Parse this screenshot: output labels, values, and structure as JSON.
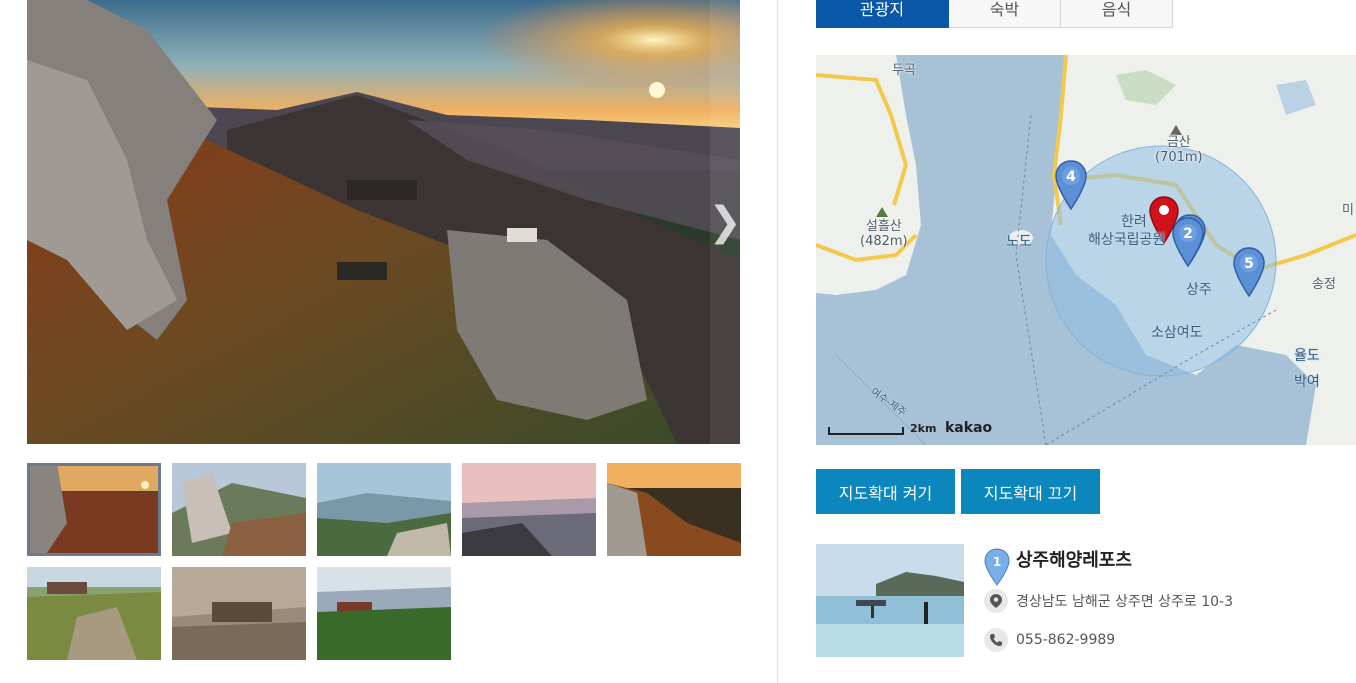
{
  "gallery": {
    "next_arrow": "❯",
    "thumbnails": [
      "thumb-1",
      "thumb-2",
      "thumb-3",
      "thumb-4",
      "thumb-5",
      "thumb-6",
      "thumb-7",
      "thumb-8"
    ],
    "active_index": 0
  },
  "tabs": [
    {
      "label": "관광지",
      "active": true
    },
    {
      "label": "숙박",
      "active": false
    },
    {
      "label": "음식",
      "active": false
    }
  ],
  "map": {
    "labels": {
      "dugok": "두곡",
      "geumsan": "금산",
      "geumsan_height": "(701m)",
      "seolheul": "설흘산",
      "seolheul_height": "(482m)",
      "nodo": "노도",
      "park1": "한려",
      "park2": "해상국립공원",
      "sangju": "상주",
      "sosamyeodo": "소삼여도",
      "songjeong": "송정",
      "yuldo": "율도",
      "bagyeo": "박여",
      "mi": "미",
      "route": "여수-제주"
    },
    "markers": [
      "4",
      "2",
      "5"
    ],
    "scale_text": "2km",
    "provider": "kakao"
  },
  "buttons": {
    "zoom_on": "지도확대 켜기",
    "zoom_off": "지도확대 끄기"
  },
  "place": {
    "marker": "1",
    "name": "상주해양레포츠",
    "address": "경상남도 남해군 상주면 상주로 10-3",
    "phone": "055-862-9989"
  },
  "colors": {
    "tab_active": "#0a57a8",
    "button": "#0b87bd",
    "marker_blue": "#5b8fd6",
    "marker_red": "#d0121b"
  }
}
